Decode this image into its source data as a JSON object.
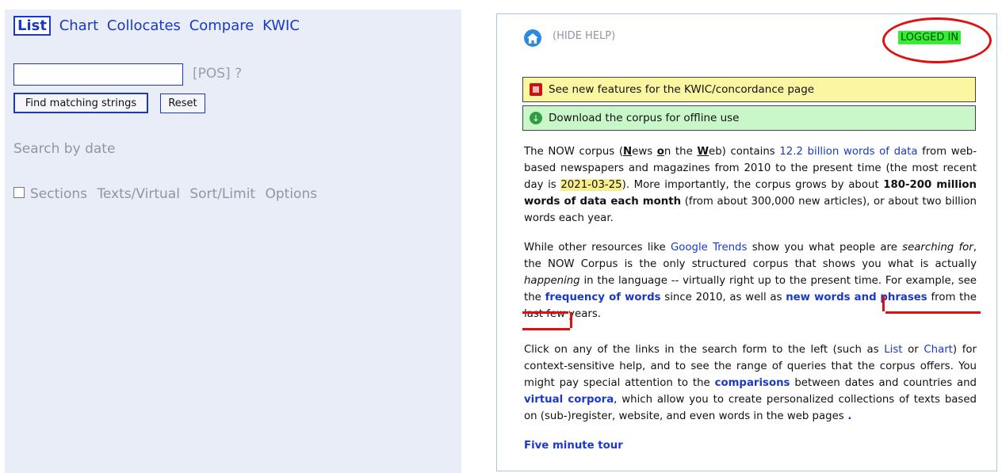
{
  "tabs": [
    "List",
    "Chart",
    "Collocates",
    "Compare",
    "KWIC"
  ],
  "active_tab": "List",
  "search": {
    "value": "",
    "placeholder": ""
  },
  "pos_link": "[POS] ?",
  "buttons": {
    "find": "Find matching strings",
    "reset": "Reset"
  },
  "search_by_date": "Search by date",
  "options": {
    "sections": "Sections",
    "texts_virtual": "Texts/Virtual",
    "sort_limit": "Sort/Limit",
    "options": "Options"
  },
  "help": {
    "hide_help": "(HIDE HELP)",
    "logged_in": "LOGGED IN",
    "features_link": "See new features for the KWIC/concordance page",
    "download_link": "Download the corpus for offline use",
    "p1": {
      "a": "The NOW corpus (",
      "n1": "N",
      "n1r": "ews ",
      "o1": "o",
      "o1r": "n the ",
      "w1": "W",
      "w1r": "eb) contains ",
      "link_words": "12.2 billion words of data",
      "b": " from web-based newspapers and magazines from 2010 to the present time (the most recent day is ",
      "date": "2021-03-25",
      "c": "). More importantly, the corpus grows by about ",
      "bold": "180-200 million words of data each month",
      "d": " (from about 300,000 new articles), or about two billion words each year."
    },
    "p2": {
      "a": "While other resources like ",
      "link_trends": "Google Trends",
      "b": " show you what people are ",
      "em1": "searching for",
      "c": ", the NOW Corpus is the only structured corpus that shows you what is actually ",
      "em2": "happening",
      "d": " in the language -- virtually right up to the present time. For example, see the ",
      "link_freq": "frequency of words",
      "e": " since 2010, as well as ",
      "link_new1": "new words and",
      "link_new2": "phrases",
      "f": " from the last few years."
    },
    "p3": {
      "a": "Click on any of the links in the search form to the left (such as ",
      "link_list": "List",
      "or": " or ",
      "link_chart": "Chart",
      "b": ") for context-sensitive help, and to see the range of queries that the corpus offers. You might pay special attention to the ",
      "link_comp": "comparisons",
      "c": " between dates and countries and ",
      "link_virtual": "virtual corpora",
      "d": ", which allow you to create personalized collections of texts based on (sub-)register, website, and even words in the web pages",
      "dot": " ."
    },
    "tour": "Five minute tour"
  }
}
